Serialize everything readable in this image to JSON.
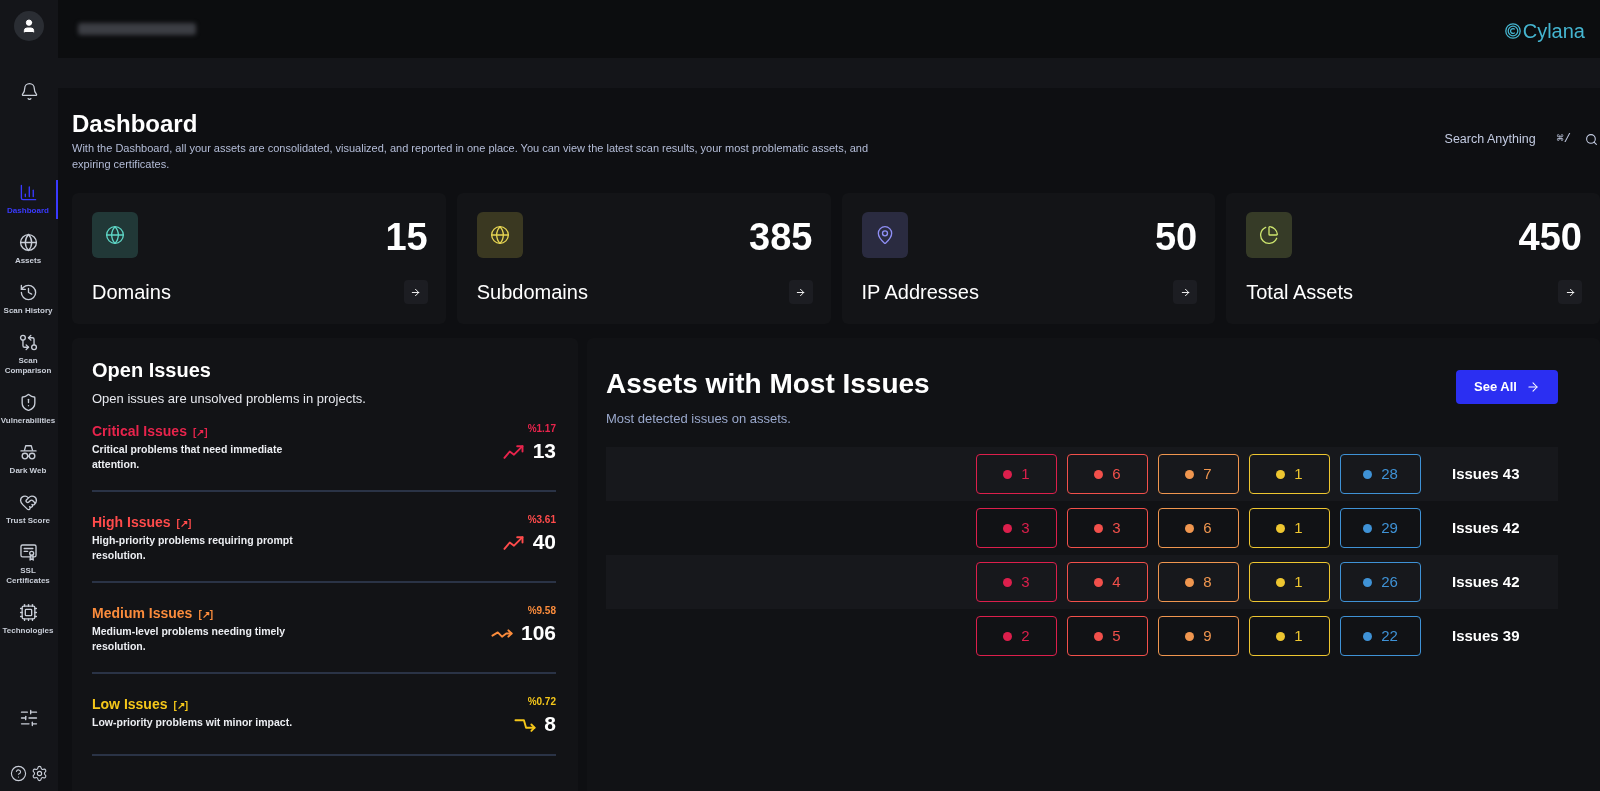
{
  "sidebar": {
    "items": [
      {
        "label": "Dashboard",
        "selected": true
      },
      {
        "label": "Assets",
        "selected": false
      },
      {
        "label": "Scan History",
        "selected": false
      },
      {
        "label": "Scan Comparison",
        "selected": false
      },
      {
        "label": "Vulnerabilities",
        "selected": false
      },
      {
        "label": "Dark Web",
        "selected": false
      },
      {
        "label": "Trust Score",
        "selected": false
      },
      {
        "label": "SSL Certificates",
        "selected": false
      },
      {
        "label": "Technologies",
        "selected": false
      }
    ]
  },
  "header": {
    "logo": "Cylana"
  },
  "page": {
    "title": "Dashboard",
    "description": "With the Dashboard, all your assets are consolidated, visualized, and reported in one place. You can view the latest scan results, your most problematic assets, and expiring certificates.",
    "search": {
      "placeholder": "Search Anything",
      "shortcut": "⌘/"
    }
  },
  "stats": [
    {
      "label": "Domains",
      "value": "15",
      "color": "#5ed6c6"
    },
    {
      "label": "Subdomains",
      "value": "385",
      "color": "#e6d552"
    },
    {
      "label": "IP Addresses",
      "value": "50",
      "color": "#8f8ff5"
    },
    {
      "label": "Total Assets",
      "value": "450",
      "color": "#cde56e"
    }
  ],
  "open_issues": {
    "title": "Open Issues",
    "subtitle": "Open issues are unsolved problems in projects.",
    "items": [
      {
        "kind": "rising",
        "title": "Critical Issues",
        "link": "[↗]",
        "description": "Critical problems that need immediate attention.",
        "percent": "%1.17",
        "count": "13",
        "color": "#e8244c"
      },
      {
        "kind": "rising",
        "title": "High Issues",
        "link": "[↗]",
        "description": "High-priority problems requiring prompt resolution.",
        "percent": "%3.61",
        "count": "40",
        "color": "#ff4b4b"
      },
      {
        "kind": "steady",
        "title": "Medium Issues",
        "link": "[↗]",
        "description": "Medium-level problems needing timely resolution.",
        "percent": "%9.58",
        "count": "106",
        "color": "#fb8c3c"
      },
      {
        "kind": "falling",
        "title": "Low Issues",
        "link": "[↗]",
        "description": "Low-priority problems wit minor impact.",
        "percent": "%0.72",
        "count": "8",
        "color": "#f5c71a"
      }
    ]
  },
  "assets": {
    "title": "Assets with Most Issues",
    "subtitle": "Most detected issues on assets.",
    "button": "See All",
    "rows": [
      {
        "counts": [
          {
            "value": "1",
            "color": "#dc1f4c"
          },
          {
            "value": "6",
            "color": "#f2504b"
          },
          {
            "value": "7",
            "color": "#f0964f"
          },
          {
            "value": "1",
            "color": "#eec630"
          },
          {
            "value": "28",
            "color": "#3f92d6"
          }
        ],
        "total": "Issues 43"
      },
      {
        "counts": [
          {
            "value": "3",
            "color": "#dc1f4c"
          },
          {
            "value": "3",
            "color": "#f2504b"
          },
          {
            "value": "6",
            "color": "#f0964f"
          },
          {
            "value": "1",
            "color": "#eec630"
          },
          {
            "value": "29",
            "color": "#3f92d6"
          }
        ],
        "total": "Issues 42"
      },
      {
        "counts": [
          {
            "value": "3",
            "color": "#dc1f4c"
          },
          {
            "value": "4",
            "color": "#f2504b"
          },
          {
            "value": "8",
            "color": "#f0964f"
          },
          {
            "value": "1",
            "color": "#eec630"
          },
          {
            "value": "26",
            "color": "#3f92d6"
          }
        ],
        "total": "Issues 42"
      },
      {
        "counts": [
          {
            "value": "2",
            "color": "#dc1f4c"
          },
          {
            "value": "5",
            "color": "#f2504b"
          },
          {
            "value": "9",
            "color": "#f0964f"
          },
          {
            "value": "1",
            "color": "#eec630"
          },
          {
            "value": "22",
            "color": "#3f92d6"
          }
        ],
        "total": "Issues 39"
      }
    ]
  }
}
